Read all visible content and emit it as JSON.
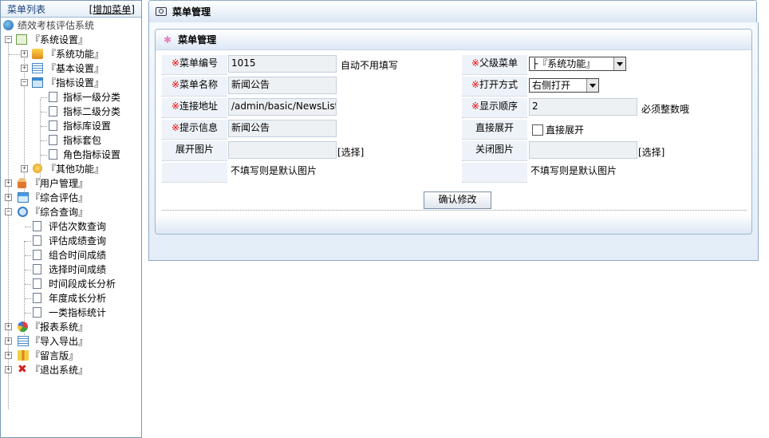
{
  "sidebar": {
    "title": "菜单列表",
    "add_link": "[增加菜单]",
    "root": "绩效考核评估系统",
    "items": [
      {
        "label": "『系统设置』"
      },
      {
        "label": "『系统功能』"
      },
      {
        "label": "『基本设置』"
      },
      {
        "label": "『指标设置』"
      },
      {
        "label": "指标一级分类"
      },
      {
        "label": "指标二级分类"
      },
      {
        "label": "指标库设置"
      },
      {
        "label": "指标套包"
      },
      {
        "label": "角色指标设置"
      },
      {
        "label": "『其他功能』"
      },
      {
        "label": "『用户管理』"
      },
      {
        "label": "『综合评估』"
      },
      {
        "label": "『综合查询』"
      },
      {
        "label": "评估次数查询"
      },
      {
        "label": "评估成绩查询"
      },
      {
        "label": "组合时间成绩"
      },
      {
        "label": "选择时间成绩"
      },
      {
        "label": "时间段成长分析"
      },
      {
        "label": "年度成长分析"
      },
      {
        "label": "一类指标统计"
      },
      {
        "label": "『报表系统』"
      },
      {
        "label": "『导入导出』"
      },
      {
        "label": "『留言版』"
      },
      {
        "label": "『退出系统』"
      }
    ]
  },
  "main": {
    "title": "菜单管理",
    "panel_title": "菜单管理",
    "required_mark": "※",
    "form": {
      "menu_no_label": "菜单编号",
      "menu_no_value": "1015",
      "menu_no_note": "自动不用填写",
      "parent_label": "父级菜单",
      "parent_value": "├『系统功能』",
      "name_label": "菜单名称",
      "name_value": "新闻公告",
      "open_label": "打开方式",
      "open_value": "右侧打开",
      "url_label": "连接地址",
      "url_value": "/admin/basic/NewsList.",
      "order_label": "显示顺序",
      "order_value": "2",
      "order_note": "必须整数哦",
      "tip_label": "提示信息",
      "tip_value": "新闻公告",
      "expand_label": "直接展开",
      "expand_check_label": "直接展开",
      "open_img_label": "展开图片",
      "choose1": "[选择]",
      "close_img_label": "关闭图片",
      "choose2": "[选择]",
      "img_note1": "不填写则是默认图片",
      "img_note2": "不填写则是默认图片"
    },
    "submit_label": "确认修改"
  }
}
